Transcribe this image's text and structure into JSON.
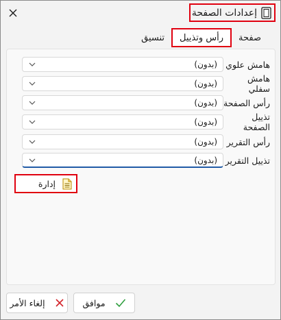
{
  "window": {
    "title": "إعدادات الصفحة",
    "title_icon": "page-setup-icon",
    "close_icon": "close-icon"
  },
  "tabs": [
    {
      "label": "صفحة",
      "active": false
    },
    {
      "label": "رأس وتذييل",
      "active": true
    },
    {
      "label": "تنسيق",
      "active": false
    }
  ],
  "fields": [
    {
      "label": "هامش علوي",
      "value": "(بدون)"
    },
    {
      "label": "هامش سفلي",
      "value": "(بدون)"
    },
    {
      "label": "رأس الصفحة",
      "value": "(بدون)"
    },
    {
      "label": "تذييل الصفحة",
      "value": "(بدون)"
    },
    {
      "label": "رأس التقرير",
      "value": "(بدون)"
    },
    {
      "label": "تذييل التقرير",
      "value": "(بدون)"
    }
  ],
  "manage": {
    "label": "إدارة",
    "icon": "document-list-icon"
  },
  "footer": {
    "ok_label": "موافق",
    "ok_icon": "checkmark-icon",
    "cancel_label": "إلغاء الأمر",
    "cancel_icon": "x-mark-icon"
  },
  "colors": {
    "highlight": "#e0000f",
    "focus": "#1f5aa6",
    "ok_check": "#2e9e3e",
    "cancel_x": "#d3232a"
  }
}
